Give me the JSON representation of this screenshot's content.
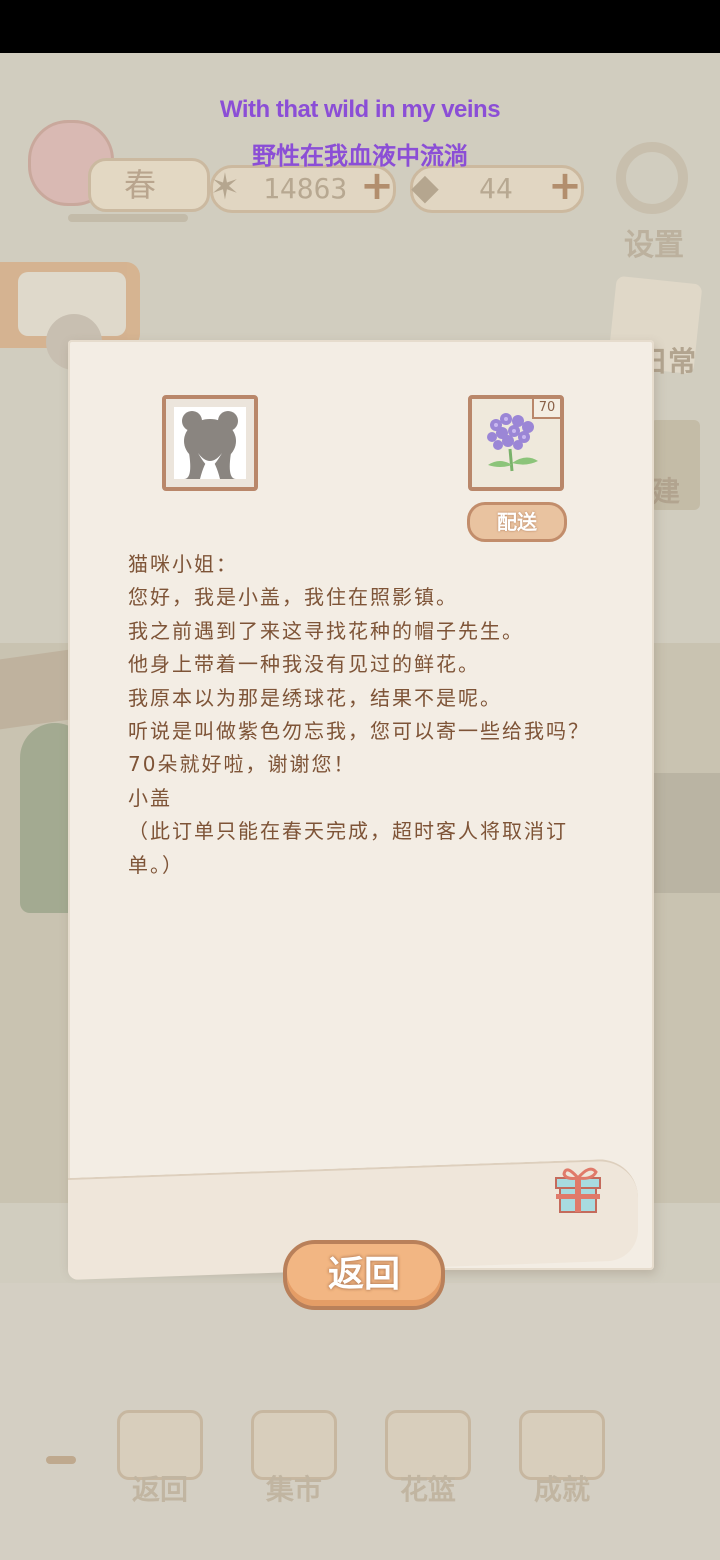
{
  "subtitle": {
    "english": "With that wild in my veins",
    "chinese": "野性在我血液中流淌"
  },
  "hud": {
    "season": "春",
    "fish_count": "14863",
    "cheese_count": "44",
    "plus": "+",
    "settings_label": "设置"
  },
  "side_tools": {
    "daily_label": "日常",
    "build_label": "建"
  },
  "letter": {
    "item_count": "70",
    "deliver_label": "配送",
    "lines": [
      "猫咪小姐：",
      "您好，我是小盖，我住在照影镇。",
      "我之前遇到了来这寻找花种的帽子先生。",
      "他身上带着一种我没有见过的鲜花。",
      "我原本以为那是绣球花，结果不是呢。",
      "听说是叫做紫色勿忘我，您可以寄一些给我吗？",
      "70朵就好啦，谢谢您！",
      "小盖",
      "（此订单只能在春天完成，超时客人将取消订单。）"
    ],
    "back_label": "返回"
  },
  "bottom_nav": {
    "items": [
      {
        "label": "返回",
        "icon": "window-icon"
      },
      {
        "label": "集市",
        "icon": "market-stall-icon"
      },
      {
        "label": "花篮",
        "icon": "flower-basket-icon"
      },
      {
        "label": "成就",
        "icon": "trophy-icon"
      }
    ]
  },
  "colors": {
    "subtitle": "#8b4ed6",
    "letter_text": "#7e5437",
    "button_orange": "#f2b683",
    "button_border": "#b9805a"
  }
}
